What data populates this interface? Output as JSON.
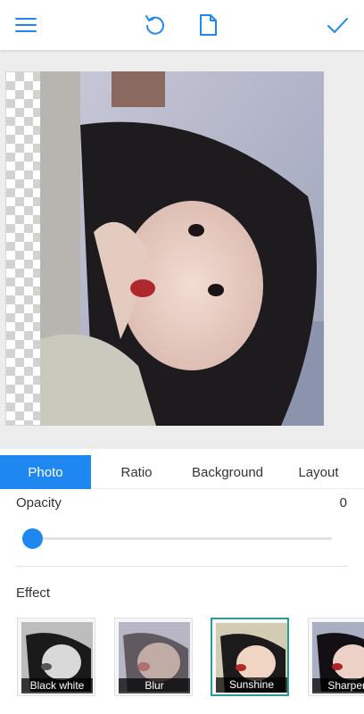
{
  "toolbar": {
    "menu_icon": "menu-icon",
    "undo_icon": "undo-icon",
    "file_icon": "document-icon",
    "confirm_icon": "checkmark-icon",
    "accent_color": "#1e88f0"
  },
  "tabs": [
    {
      "label": "Photo",
      "active": true
    },
    {
      "label": "Ratio",
      "active": false
    },
    {
      "label": "Background",
      "active": false
    },
    {
      "label": "Layout",
      "active": false
    }
  ],
  "opacity": {
    "label": "Opacity",
    "value": "0",
    "slider_fraction": 0
  },
  "effect": {
    "label": "Effect",
    "items": [
      {
        "label": "Black white",
        "selected": false
      },
      {
        "label": "Blur",
        "selected": false
      },
      {
        "label": "Sunshine",
        "selected": true
      },
      {
        "label": "Sharpen",
        "selected": false
      }
    ]
  }
}
